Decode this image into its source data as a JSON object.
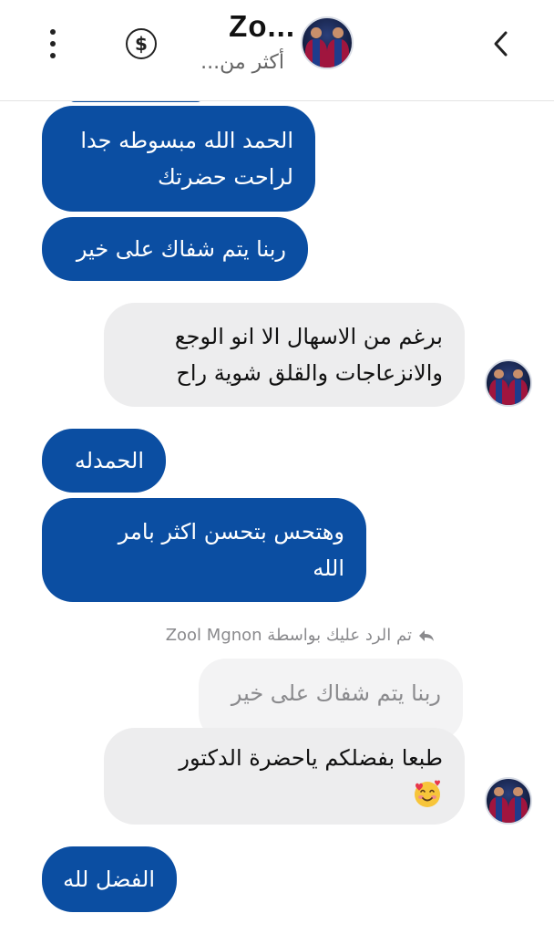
{
  "header": {
    "title": "Zo...",
    "subtitle": "أكثر من...",
    "menu_icon": "more-vertical-icon",
    "payment_icon": "dollar-circle-icon",
    "back_icon": "chevron-left-icon"
  },
  "messages": [
    {
      "side": "out",
      "lines": [
        "الحمد الله مبسوطه جدا",
        "لراحت حضرتك"
      ]
    },
    {
      "side": "out",
      "lines": [
        "ربنا يتم شفاك على خير"
      ]
    },
    {
      "side": "in",
      "lines": [
        "برغم من الاسهال الا انو الوجع",
        "والانزعاجات والقلق شوية راح"
      ]
    },
    {
      "side": "out",
      "lines": [
        "الحمدله"
      ]
    },
    {
      "side": "out",
      "lines": [
        "وهتحس بتحسن اكثر بامر",
        "الله"
      ]
    },
    {
      "side": "in",
      "reply_note": "تم الرد عليك بواسطة Zool Mgnon",
      "quoted": "ربنا يتم شفاك على خير",
      "lines": [
        "طبعا بفضلكم ياحضرة الدكتور",
        ""
      ],
      "emoji": "smiling-face-with-hearts-icon"
    },
    {
      "side": "out",
      "lines": [
        "الفضل لله"
      ]
    }
  ],
  "colors": {
    "outgoing_bubble": "#0b4ea2",
    "incoming_bubble": "#ededee",
    "quoted_bubble": "#f3f3f4"
  }
}
